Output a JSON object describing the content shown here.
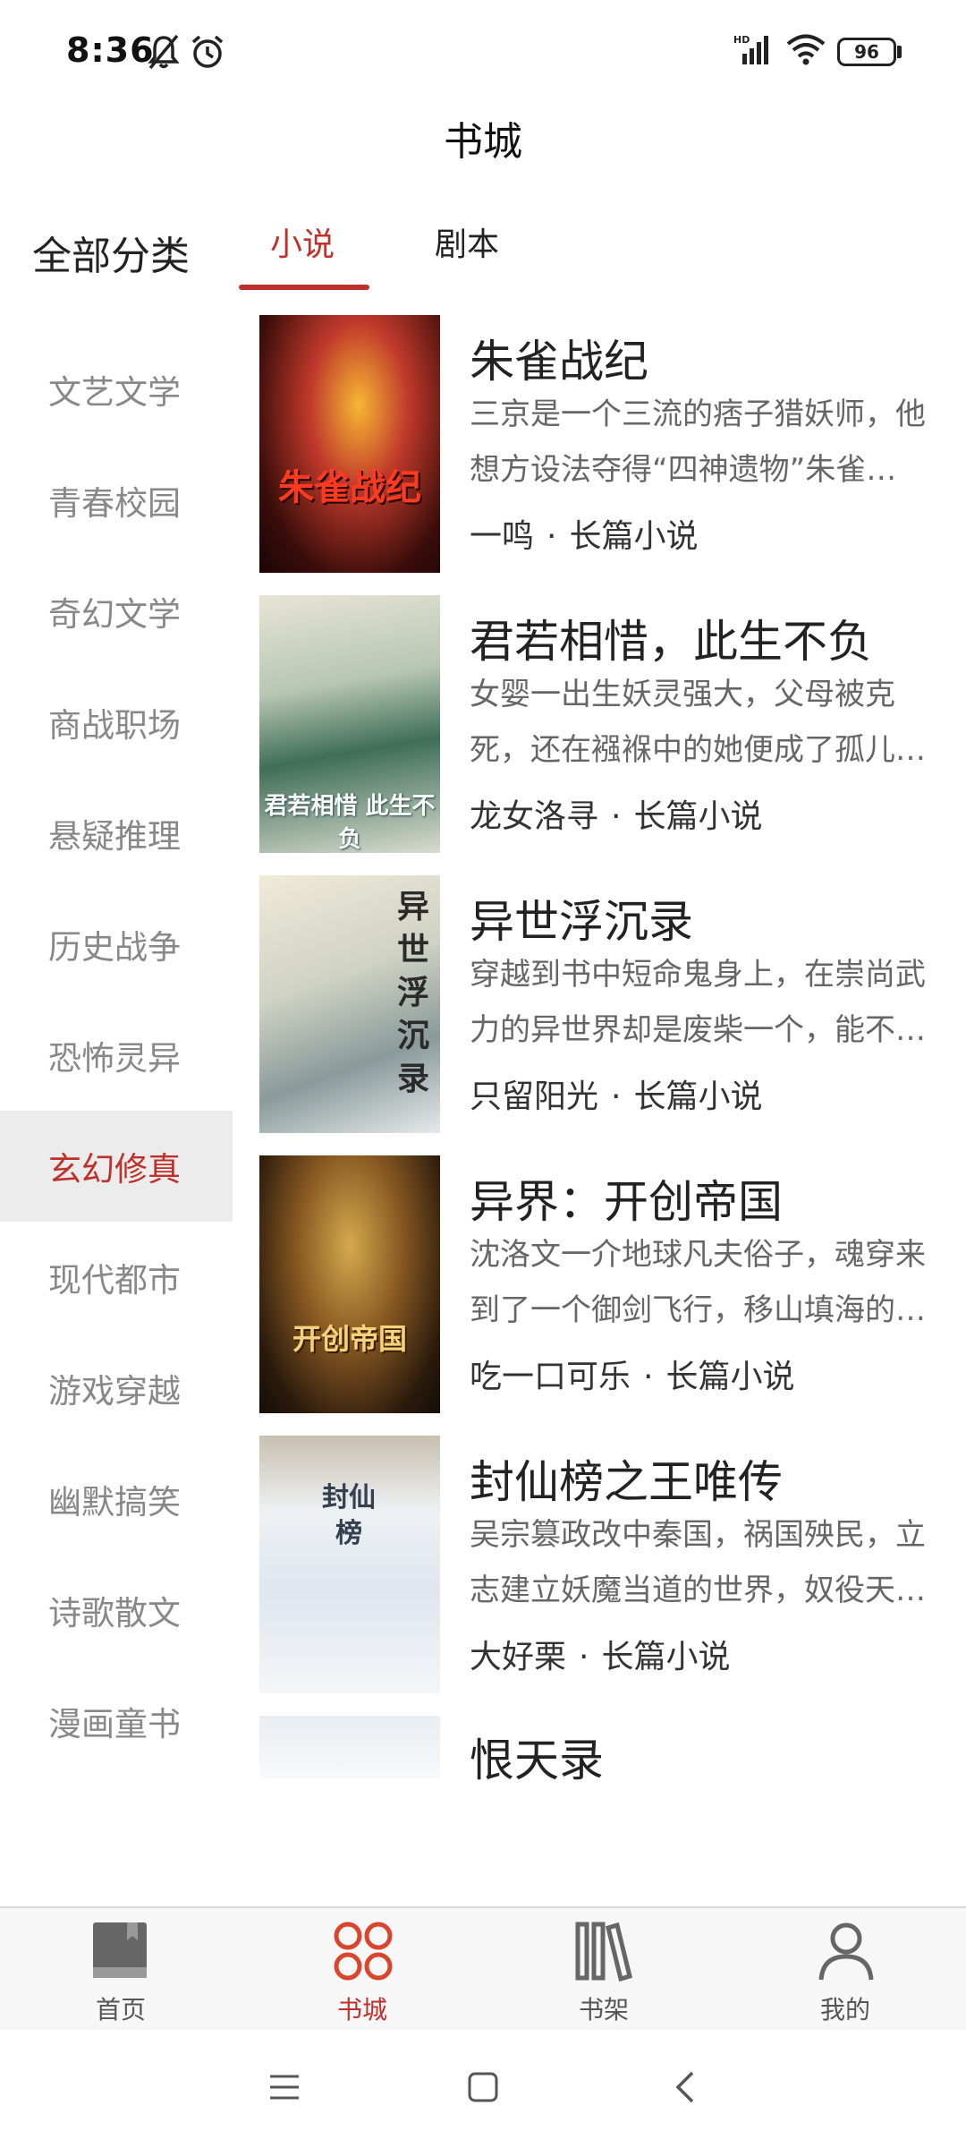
{
  "status_bar": {
    "time": "8:36",
    "battery": "96"
  },
  "header": {
    "title": "书城"
  },
  "tabs": {
    "all_categories": "全部分类",
    "novel": "小说",
    "script": "剧本"
  },
  "categories": [
    "文艺文学",
    "青春校园",
    "奇幻文学",
    "商战职场",
    "悬疑推理",
    "历史战争",
    "恐怖灵异",
    "玄幻修真",
    "现代都市",
    "游戏穿越",
    "幽默搞笑",
    "诗歌散文",
    "漫画童书"
  ],
  "selected_category": "玄幻修真",
  "books": [
    {
      "title": "朱雀战纪",
      "desc": "三京是一个三流的痞子猎妖师，他想方设法夺得“四神遗物”朱雀…",
      "author": "一鸣",
      "type": "长篇小说",
      "cover_text": "朱雀战纪"
    },
    {
      "title": "君若相惜，此生不负",
      "desc": "女婴一出生妖灵强大，父母被克死，还在襁褓中的她便成了孤儿…",
      "author": "龙女洛寻",
      "type": "长篇小说",
      "cover_text": "君若相惜 此生不负"
    },
    {
      "title": "异世浮沉录",
      "desc": "穿越到书中短命鬼身上，在崇尚武力的异世界却是废柴一个，能不…",
      "author": "只留阳光",
      "type": "长篇小说",
      "cover_text": "异世浮沉录"
    },
    {
      "title": "异界：开创帝国",
      "desc": "沈洛文一介地球凡夫俗子，魂穿来到了一个御剑飞行，移山填海的…",
      "author": "吃一口可乐",
      "type": "长篇小说",
      "cover_text": "开创帝国"
    },
    {
      "title": "封仙榜之王唯传",
      "desc": "吴宗篡政改中秦国，祸国殃民，立志建立妖魔当道的世界，奴役天…",
      "author": "大好栗",
      "type": "长篇小说",
      "cover_text": "封仙榜"
    },
    {
      "title": "恨天录"
    }
  ],
  "bottom_nav": [
    {
      "label": "首页",
      "icon": "book-icon"
    },
    {
      "label": "书城",
      "icon": "grid-icon",
      "active": true
    },
    {
      "label": "书架",
      "icon": "bookshelf-icon"
    },
    {
      "label": "我的",
      "icon": "user-icon"
    }
  ],
  "colors": {
    "accent": "#c0302b",
    "sidebar_active_bg": "#ececec"
  }
}
